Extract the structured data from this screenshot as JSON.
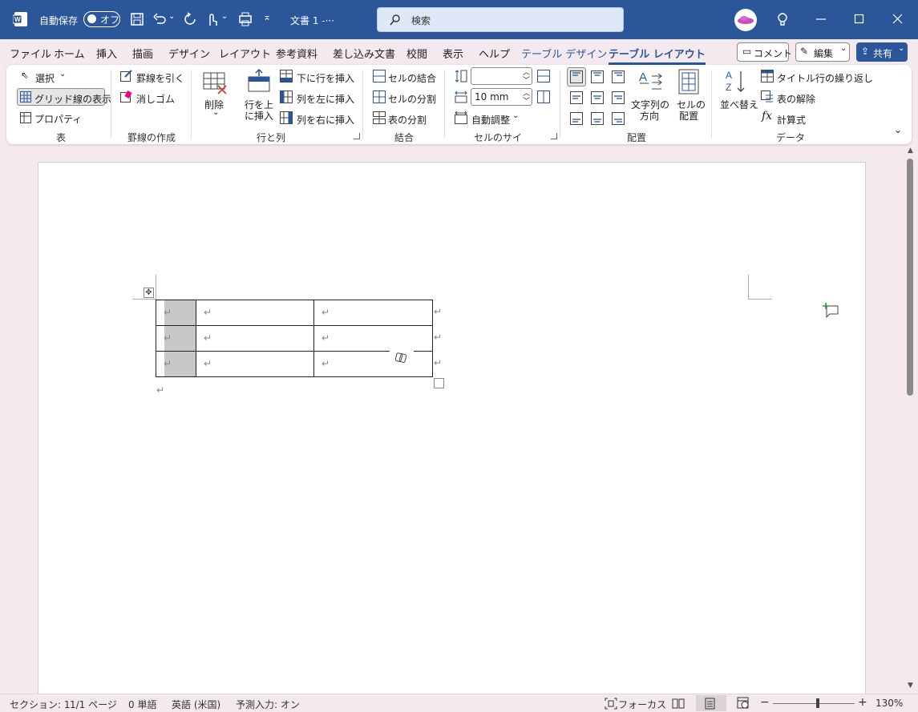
{
  "titlebar": {
    "autosave_label": "自動保存",
    "autosave_state": "オフ",
    "doc_title": "文書 1  -···",
    "search_placeholder": "検索",
    "icons": [
      "word-logo-icon",
      "save-icon",
      "undo-icon",
      "redo-icon",
      "touch-mode-icon",
      "print-preview-icon",
      "customize-qat-icon",
      "search-icon",
      "lightbulb-icon",
      "minimize-icon",
      "maximize-icon",
      "close-icon"
    ]
  },
  "tabs": {
    "items": [
      "ファイル",
      "ホーム",
      "挿入",
      "描画",
      "デザイン",
      "レイアウト",
      "参考資料",
      "差し込み文書",
      "校閲",
      "表示",
      "ヘルプ"
    ],
    "ctx_table_design": "テーブル デザイン",
    "ctx_table_layout": "テーブル レイアウト",
    "comment_btn": "コメント",
    "edit_btn": "編集",
    "share_btn": "共有"
  },
  "ribbon": {
    "table": {
      "select": "選択",
      "gridlines": "グリッド線の表示",
      "properties": "プロパティ",
      "label": "表"
    },
    "draw": {
      "draw_border": "罫線を引く",
      "eraser": "消しゴム",
      "label": "罫線の作成"
    },
    "rowcol": {
      "delete": "削除",
      "insert_above_1": "行を上",
      "insert_above_2": "に挿入",
      "insert_below": "下に行を挿入",
      "insert_left": "列を左に挿入",
      "insert_right": "列を右に挿入",
      "label": "行と列"
    },
    "merge": {
      "merge_cells": "セルの結合",
      "split_cells": "セルの分割",
      "split_table": "表の分割",
      "label": "結合"
    },
    "cellsize": {
      "height_value": "",
      "width_value": "10 mm",
      "autofit": "自動調整",
      "label": "セルのサイズ"
    },
    "alignment": {
      "text_direction_1": "文字列の",
      "text_direction_2": "方向",
      "cell_margins_1": "セルの",
      "cell_margins_2": "配置",
      "label": "配置"
    },
    "data": {
      "sort": "並べ替え",
      "repeat_header": "タイトル行の繰り返し",
      "convert_text": "表の解除",
      "formula": "計算式",
      "label": "データ"
    }
  },
  "document": {
    "rows": 3,
    "cols": 3,
    "return_mark": "↵"
  },
  "statusbar": {
    "section": "セクション: 1",
    "page": "1/1 ページ",
    "words": "0 単語",
    "language": "英語 (米国)",
    "predictive": "予測入力: オン",
    "focus": "フォーカス",
    "zoom": "130%"
  },
  "colors": {
    "accent": "#2b579a",
    "chrome": "#f3e9ee"
  }
}
